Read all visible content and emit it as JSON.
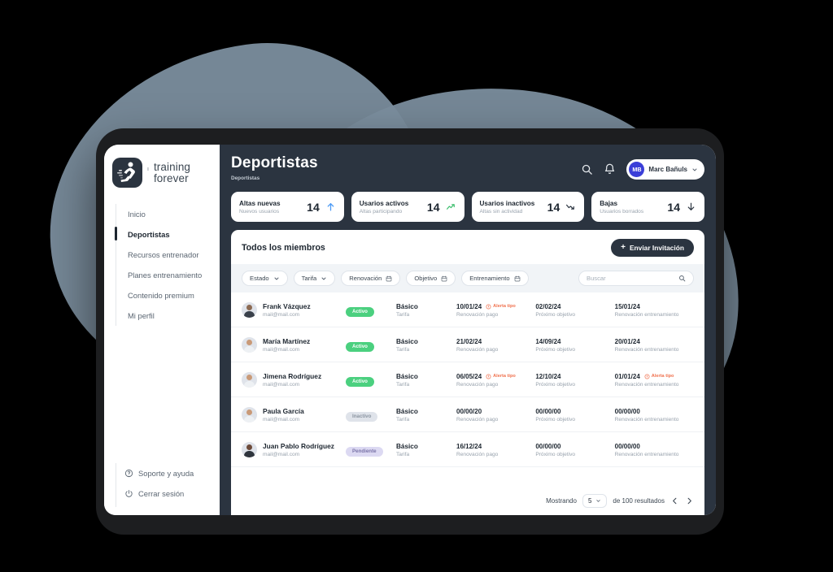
{
  "brand": {
    "tick": "ı",
    "line1": "training",
    "line2": "forever",
    "logo_icon": "runner-icon"
  },
  "sidebar": {
    "items": [
      {
        "label": "Inicio"
      },
      {
        "label": "Deportistas"
      },
      {
        "label": "Recursos entrenador"
      },
      {
        "label": "Planes entrenamiento"
      },
      {
        "label": "Contenido premium"
      },
      {
        "label": "Mi perfil"
      }
    ],
    "bottom": [
      {
        "label": "Soporte y ayuda",
        "icon": "help-circle-icon"
      },
      {
        "label": "Cerrar sesión",
        "icon": "power-icon"
      }
    ]
  },
  "header": {
    "title": "Deportistas",
    "breadcrumb": "Deportistas",
    "search_icon": "search-icon",
    "bell_icon": "bell-icon",
    "user": {
      "initials": "MB",
      "name": "Marc Bañuls",
      "avatar_color": "#3b3fd8"
    }
  },
  "stats": [
    {
      "label": "Altas nuevas",
      "sub": "Nuevos usuarios",
      "value": "14",
      "trend": "arrow-up",
      "color": "#4d9bf5"
    },
    {
      "label": "Usarios activos",
      "sub": "Altas participando",
      "value": "14",
      "trend": "trend-up",
      "color": "#3fbf6f"
    },
    {
      "label": "Usarios inactivos",
      "sub": "Altas sin actividad",
      "value": "14",
      "trend": "trend-down",
      "color": "#2b3440"
    },
    {
      "label": "Bajas",
      "sub": "Usuarios borrados",
      "value": "14",
      "trend": "arrow-down",
      "color": "#2b3440"
    }
  ],
  "panel": {
    "title": "Todos los miembros",
    "invite_label": "Enviar Invitación",
    "invite_plus": "+"
  },
  "filters": [
    {
      "label": "Estado",
      "icon": "chevron-down-icon"
    },
    {
      "label": "Tarifa",
      "icon": "chevron-down-icon"
    },
    {
      "label": "Renovación",
      "icon": "calendar-icon"
    },
    {
      "label": "Objetivo",
      "icon": "calendar-icon"
    },
    {
      "label": "Entrenamiento",
      "icon": "calendar-icon"
    }
  ],
  "search": {
    "placeholder": "Buscar",
    "value": "",
    "icon": "search-icon"
  },
  "alert_label": "Alerta tipo",
  "rows": [
    {
      "name": "Frank Vázquez",
      "mail": "mail@mail.com",
      "status": "Activo",
      "status_kind": "activo",
      "plan": "Básico",
      "plan_sub": "Tarifa",
      "d1": "10/01/24",
      "d1_sub": "Renovación pago",
      "d1_alert": true,
      "d2": "02/02/24",
      "d2_sub": "Próximo objetivo",
      "d2_alert": false,
      "d3": "15/01/24",
      "d3_sub": "Renovación entrenamiento",
      "d3_alert": false
    },
    {
      "name": "María Martínez",
      "mail": "mail@mail.com",
      "status": "Activo",
      "status_kind": "activo",
      "plan": "Básico",
      "plan_sub": "Tarifa",
      "d1": "21/02/24",
      "d1_sub": "Renovación pago",
      "d1_alert": false,
      "d2": "14/09/24",
      "d2_sub": "Próximo objetivo",
      "d2_alert": false,
      "d3": "20/01/24",
      "d3_sub": "Renovación entrenamiento",
      "d3_alert": false
    },
    {
      "name": "Jimena Rodríguez",
      "mail": "mail@mail.com",
      "status": "Activo",
      "status_kind": "activo",
      "plan": "Básico",
      "plan_sub": "Tarifa",
      "d1": "06/05/24",
      "d1_sub": "Renovación pago",
      "d1_alert": true,
      "d2": "12/10/24",
      "d2_sub": "Próximo objetivo",
      "d2_alert": false,
      "d3": "01/01/24",
      "d3_sub": "Renovación entrenamiento",
      "d3_alert": true
    },
    {
      "name": "Paula García",
      "mail": "mail@mail.com",
      "status": "Inactivo",
      "status_kind": "inactivo",
      "plan": "Básico",
      "plan_sub": "Tarifa",
      "d1": "00/00/20",
      "d1_sub": "Renovación pago",
      "d1_alert": false,
      "d2": "00/00/00",
      "d2_sub": "Próximo objetivo",
      "d2_alert": false,
      "d3": "00/00/00",
      "d3_sub": "Renovación entrenamiento",
      "d3_alert": false
    },
    {
      "name": "Juan Pablo Rodríguez",
      "mail": "mail@mail.com",
      "status": "Pendiente",
      "status_kind": "pendiente",
      "plan": "Básico",
      "plan_sub": "Tarifa",
      "d1": "16/12/24",
      "d1_sub": "Renovación pago",
      "d1_alert": false,
      "d2": "00/00/00",
      "d2_sub": "Próximo objetivo",
      "d2_alert": false,
      "d3": "00/00/00",
      "d3_sub": "Renovación entrenamiento",
      "d3_alert": false
    }
  ],
  "pager": {
    "prefix": "Mostrando",
    "page_size": "5",
    "suffix": "de 100 resultados",
    "prev_icon": "chevron-left-icon",
    "next_icon": "chevron-right-icon"
  }
}
